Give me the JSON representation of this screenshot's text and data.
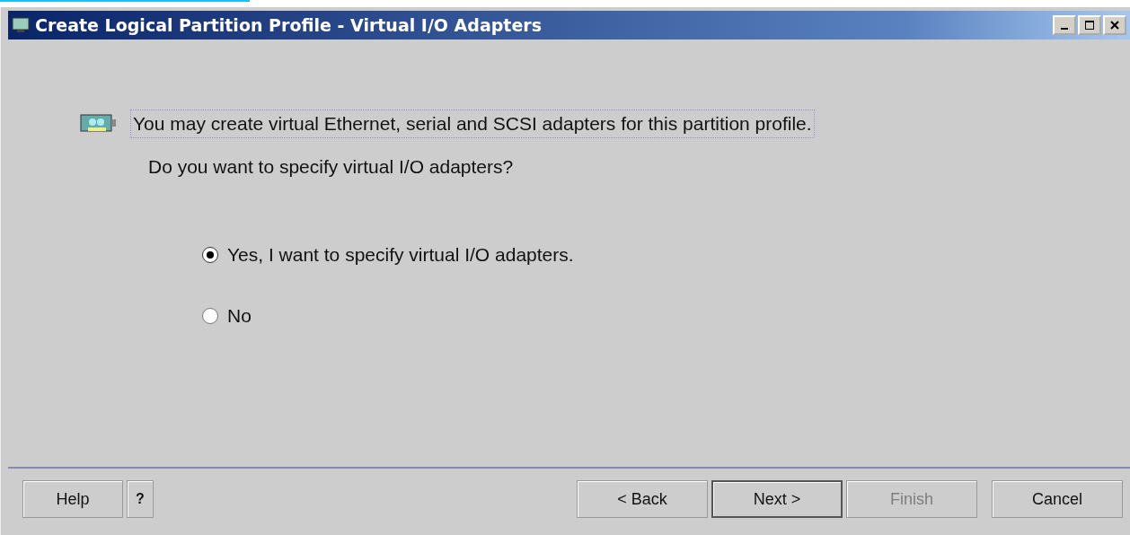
{
  "window": {
    "title": "Create Logical Partition Profile - Virtual I/O Adapters"
  },
  "intro": "You may create virtual Ethernet, serial and SCSI adapters for this partition profile.",
  "question": "Do you want to specify virtual I/O adapters?",
  "options": [
    {
      "label": "Yes, I want to specify virtual I/O adapters.",
      "selected": true
    },
    {
      "label": "No",
      "selected": false
    }
  ],
  "left_buttons": [
    {
      "label": "Help",
      "disabled": false,
      "default": false
    },
    {
      "label": "?",
      "disabled": false,
      "default": false
    }
  ],
  "right_buttons": [
    {
      "label": "< Back",
      "disabled": false,
      "default": false
    },
    {
      "label": "Next >",
      "disabled": false,
      "default": true
    },
    {
      "label": "Finish",
      "disabled": true,
      "default": false
    },
    {
      "label": "Cancel",
      "disabled": false,
      "default": false
    }
  ]
}
